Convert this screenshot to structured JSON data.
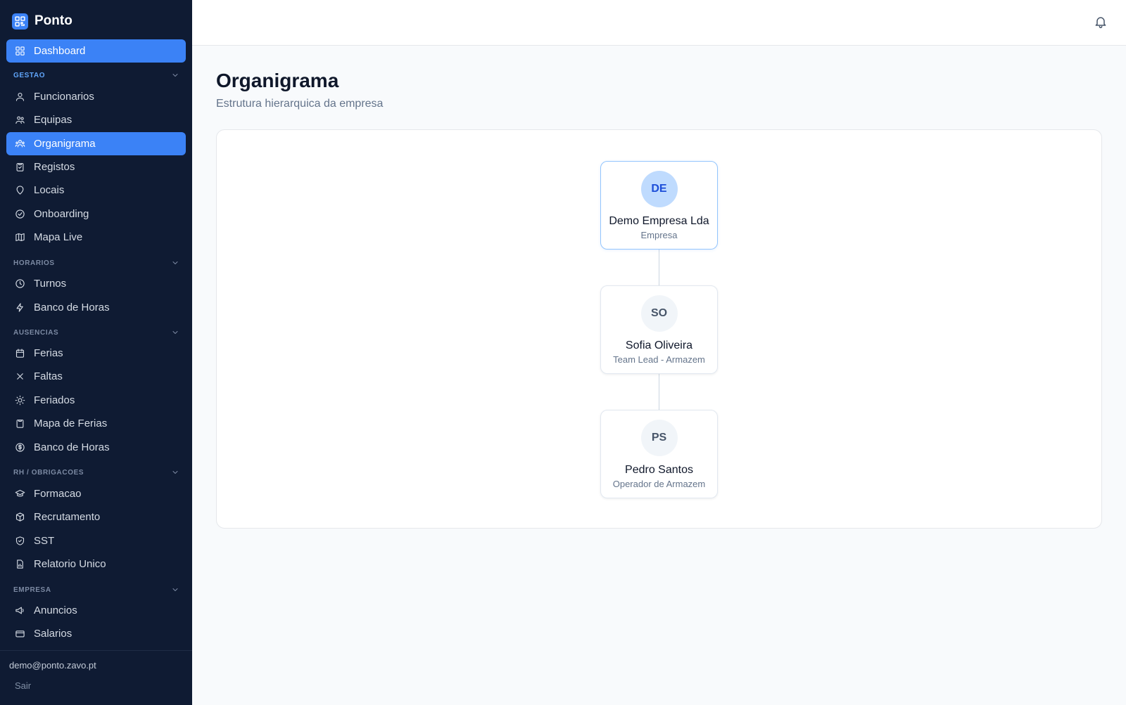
{
  "app": {
    "name": "Ponto"
  },
  "sidebar": {
    "dashboard": {
      "label": "Dashboard"
    },
    "sections": {
      "gestao": {
        "label": "GESTAO",
        "items": [
          {
            "label": "Funcionarios",
            "icon": "users-icon"
          },
          {
            "label": "Equipas",
            "icon": "team-icon"
          },
          {
            "label": "Organigrama",
            "icon": "org-icon",
            "active": true
          },
          {
            "label": "Registos",
            "icon": "clipboard-icon"
          },
          {
            "label": "Locais",
            "icon": "location-icon"
          },
          {
            "label": "Onboarding",
            "icon": "check-circle-icon"
          },
          {
            "label": "Mapa Live",
            "icon": "map-icon"
          }
        ]
      },
      "horarios": {
        "label": "HORARIOS",
        "items": [
          {
            "label": "Turnos",
            "icon": "clock-icon"
          },
          {
            "label": "Banco de Horas",
            "icon": "bolt-icon"
          }
        ]
      },
      "ausencias": {
        "label": "AUSENCIAS",
        "items": [
          {
            "label": "Ferias",
            "icon": "calendar-icon"
          },
          {
            "label": "Faltas",
            "icon": "x-icon"
          },
          {
            "label": "Feriados",
            "icon": "sun-icon"
          },
          {
            "label": "Mapa de Ferias",
            "icon": "clipboard-icon"
          },
          {
            "label": "Banco de Horas",
            "icon": "dollar-icon"
          }
        ]
      },
      "rh": {
        "label": "RH / OBRIGACOES",
        "items": [
          {
            "label": "Formacao",
            "icon": "graduation-icon"
          },
          {
            "label": "Recrutamento",
            "icon": "box-icon"
          },
          {
            "label": "SST",
            "icon": "shield-icon"
          },
          {
            "label": "Relatorio Unico",
            "icon": "document-icon"
          }
        ]
      },
      "empresa": {
        "label": "EMPRESA",
        "items": [
          {
            "label": "Anuncios",
            "icon": "megaphone-icon"
          },
          {
            "label": "Salarios",
            "icon": "card-icon"
          }
        ]
      }
    },
    "user_email": "demo@ponto.zavo.pt",
    "logout_label": "Sair"
  },
  "header": {
    "notifications_icon": "bell-icon"
  },
  "main": {
    "title": "Organigrama",
    "subtitle": "Estrutura hierarquica da empresa",
    "org_chart": {
      "nodes": [
        {
          "initials": "DE",
          "name": "Demo Empresa Lda",
          "role": "Empresa"
        },
        {
          "initials": "SO",
          "name": "Sofia Oliveira",
          "role": "Team Lead - Armazem"
        },
        {
          "initials": "PS",
          "name": "Pedro Santos",
          "role": "Operador de Armazem"
        }
      ]
    }
  },
  "colors": {
    "sidebar_bg": "#0f1b33",
    "accent": "#3b82f6",
    "root_avatar_bg": "#bfdbfe",
    "root_avatar_text": "#1d4ed8"
  }
}
